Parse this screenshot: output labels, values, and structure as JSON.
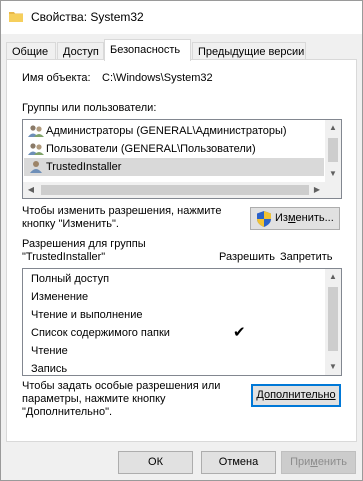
{
  "window": {
    "title": "Свойства: System32",
    "folder_icon": "folder-icon"
  },
  "tabs": [
    {
      "label": "Общие"
    },
    {
      "label": "Доступ"
    },
    {
      "label": "Безопасность",
      "active": true
    },
    {
      "label": "Предыдущие версии"
    }
  ],
  "object": {
    "label": "Имя объекта:",
    "value": "C:\\Windows\\System32"
  },
  "groups": {
    "label": "Группы или пользователи:",
    "items": [
      {
        "label": "Администраторы (GENERAL\\Администраторы)",
        "icon": "users-icon"
      },
      {
        "label": "Пользователи (GENERAL\\Пользователи)",
        "icon": "users-icon"
      },
      {
        "label": "TrustedInstaller",
        "icon": "user-icon",
        "selected": true
      }
    ]
  },
  "change": {
    "hint": "Чтобы изменить разрешения, нажмите кнопку \"Изменить\".",
    "button_prefix": "Из",
    "button_accel": "м",
    "button_suffix": "енить...",
    "icon": "uac-shield-icon"
  },
  "permissions": {
    "header_line1": "Разрешения для группы",
    "header_line2": "\"TrustedInstaller\"",
    "allow_label": "Разрешить",
    "deny_label": "Запретить",
    "rows": [
      {
        "label": "Полный доступ",
        "allow": false,
        "deny": false
      },
      {
        "label": "Изменение",
        "allow": false,
        "deny": false
      },
      {
        "label": "Чтение и выполнение",
        "allow": false,
        "deny": false
      },
      {
        "label": "Список содержимого папки",
        "allow": true,
        "deny": false
      },
      {
        "label": "Чтение",
        "allow": false,
        "deny": false
      },
      {
        "label": "Запись",
        "allow": false,
        "deny": false
      }
    ]
  },
  "advanced": {
    "hint_line1": "Чтобы задать особые разрешения или",
    "hint_line2": "параметры, нажмите кнопку",
    "hint_line3": "\"Дополнительно\".",
    "button_label": "Дополнительно"
  },
  "footer": {
    "ok": "ОК",
    "cancel": "Отмена",
    "apply_prefix": "При",
    "apply_accel": "м",
    "apply_suffix": "енить"
  }
}
